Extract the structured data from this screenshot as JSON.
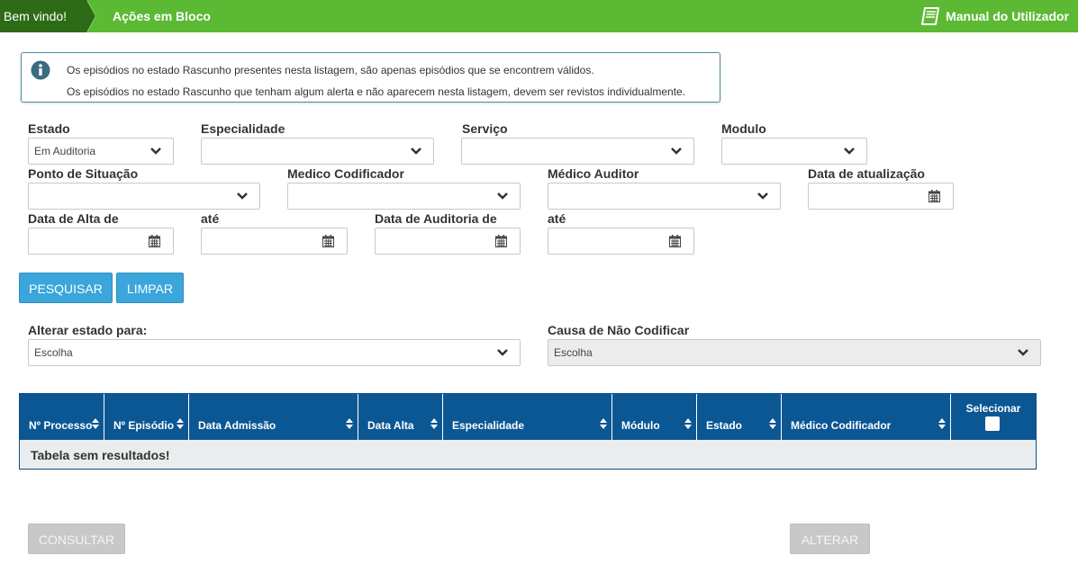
{
  "header": {
    "home": "Bem vindo!",
    "current": "Ações em Bloco",
    "manual": "Manual do Utilizador"
  },
  "info": {
    "line1": "Os episódios no estado Rascunho presentes nesta listagem, são apenas episódios que se encontrem válidos.",
    "line2": "Os episódios no estado Rascunho que tenham algum alerta e não aparecem nesta listagem, devem ser revistos individualmente."
  },
  "filters": {
    "estado": {
      "label": "Estado",
      "value": "Em Auditoria"
    },
    "especialidade": {
      "label": "Especialidade",
      "value": ""
    },
    "servico": {
      "label": "Serviço",
      "value": ""
    },
    "modulo": {
      "label": "Modulo",
      "value": ""
    },
    "ponto_situacao": {
      "label": "Ponto de Situação",
      "value": ""
    },
    "medico_codificador": {
      "label": "Medico Codificador",
      "value": ""
    },
    "medico_auditor": {
      "label": "Médico Auditor",
      "value": ""
    },
    "data_atualizacao": {
      "label": "Data de atualização",
      "value": ""
    },
    "data_alta_de": {
      "label": "Data de Alta de",
      "value": ""
    },
    "data_alta_ate": {
      "label": "até",
      "value": ""
    },
    "data_auditoria_de": {
      "label": "Data de Auditoria de",
      "value": ""
    },
    "data_auditoria_ate": {
      "label": "até",
      "value": ""
    }
  },
  "buttons": {
    "pesquisar": "PESQUISAR",
    "limpar": "LIMPAR",
    "consultar": "CONSULTAR",
    "alterar": "ALTERAR"
  },
  "change": {
    "estado_label": "Alterar estado para:",
    "estado_value": "Escolha",
    "causa_label": "Causa de Não Codificar",
    "causa_value": "Escolha"
  },
  "table": {
    "columns": [
      "Nº Processo",
      "Nº Episódio",
      "Data Admissão",
      "Data Alta",
      "Especialidade",
      "Módulo",
      "Estado",
      "Médico Codificador",
      "Selecionar"
    ],
    "empty": "Tabela sem resultados!"
  },
  "colors": {
    "header_green": "#5cb934",
    "header_dark_green": "#2e6b17",
    "table_header": "#0b5794",
    "button_blue": "#3aa6dc",
    "button_disabled": "#c8c8c8"
  }
}
